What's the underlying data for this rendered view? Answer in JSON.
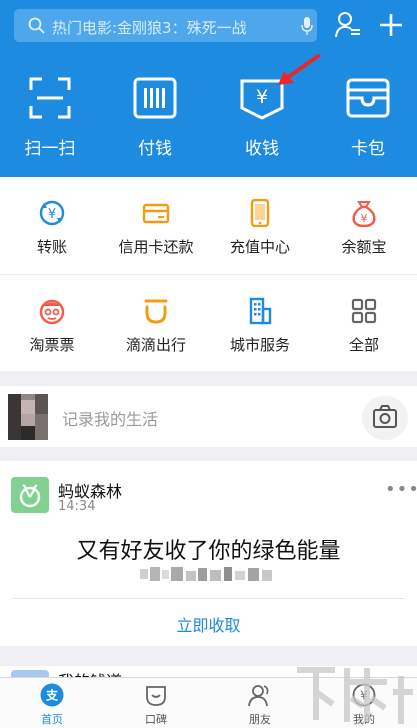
{
  "search": {
    "placeholder": "热门电影:金刚狼3：殊死一战"
  },
  "top_actions": [
    {
      "label": "扫一扫",
      "icon": "scan-icon"
    },
    {
      "label": "付钱",
      "icon": "barcode-icon"
    },
    {
      "label": "收钱",
      "icon": "yuan-receipt-icon"
    },
    {
      "label": "卡包",
      "icon": "wallet-icon"
    }
  ],
  "services": [
    {
      "label": "转账",
      "icon": "transfer-icon"
    },
    {
      "label": "信用卡还款",
      "icon": "credit-card-icon"
    },
    {
      "label": "充值中心",
      "icon": "phone-recharge-icon"
    },
    {
      "label": "余额宝",
      "icon": "money-bag-icon"
    },
    {
      "label": "淘票票",
      "icon": "taopiaopiao-icon"
    },
    {
      "label": "滴滴出行",
      "icon": "didi-icon"
    },
    {
      "label": "城市服务",
      "icon": "city-building-icon"
    },
    {
      "label": "全部",
      "icon": "grid-all-icon"
    }
  ],
  "life": {
    "placeholder": "记录我的生活"
  },
  "forest_card": {
    "title": "蚂蚁森林",
    "time": "14:34",
    "message": "又有好友收了你的绿色能量",
    "action": "立即收取",
    "more": "•••"
  },
  "peek": {
    "title": "我的钱道"
  },
  "tabs": [
    {
      "label": "首页",
      "icon": "home-alipay-icon"
    },
    {
      "label": "口碑",
      "icon": "koubei-icon"
    },
    {
      "label": "朋友",
      "icon": "friends-icon"
    },
    {
      "label": "我的",
      "icon": "me-yuan-icon"
    }
  ],
  "colors": {
    "brand": "#1d8ce0",
    "accent_orange": "#f39c12",
    "accent_red": "#f35a4a",
    "forest_green": "#83d191"
  }
}
